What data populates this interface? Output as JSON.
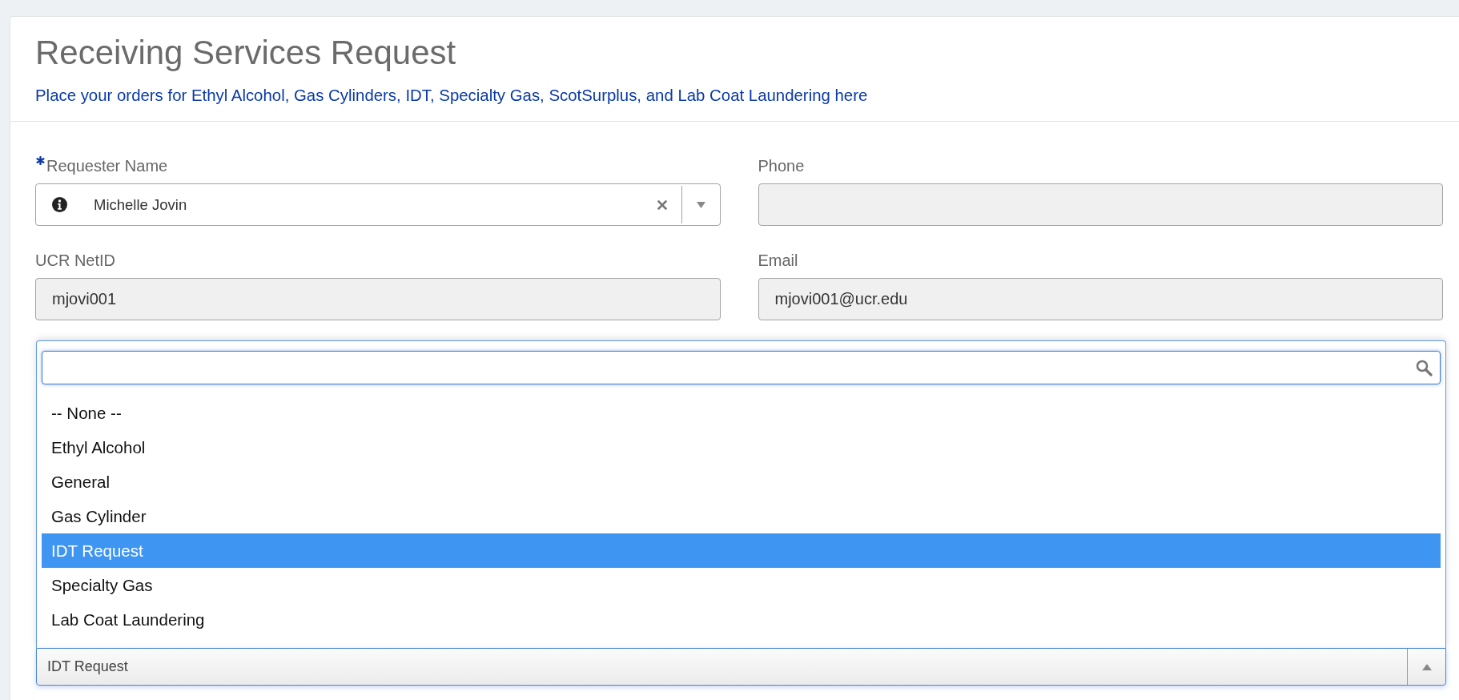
{
  "page": {
    "title": "Receiving Services Request",
    "subtitle": "Place your orders for Ethyl Alcohol, Gas Cylinders, IDT, Specialty Gas, ScotSurplus, and Lab Coat Laundering here"
  },
  "fields": [
    {
      "kind": "lookup",
      "label": "Requester Name",
      "required": true,
      "readonly": false,
      "value": "Michelle Jovin"
    },
    {
      "kind": "text",
      "label": "Phone",
      "required": false,
      "readonly": true
    },
    {
      "kind": "text",
      "label": "UCR NetID",
      "required": false,
      "readonly": true,
      "value": "mjovi001"
    },
    {
      "kind": "text",
      "label": "Email",
      "required": false,
      "readonly": true,
      "value": "mjovi001@ucr.edu"
    }
  ],
  "request_type": {
    "value": "IDT Request",
    "expanded": true,
    "options": [
      {
        "label": "-- None --",
        "selected": false
      },
      {
        "label": "Ethyl Alcohol",
        "selected": false
      },
      {
        "label": "General",
        "selected": false
      },
      {
        "label": "Gas Cylinder",
        "selected": false
      },
      {
        "label": "IDT Request",
        "selected": true
      },
      {
        "label": "Specialty Gas",
        "selected": false
      },
      {
        "label": "Lab Coat Laundering",
        "selected": false
      }
    ]
  }
}
